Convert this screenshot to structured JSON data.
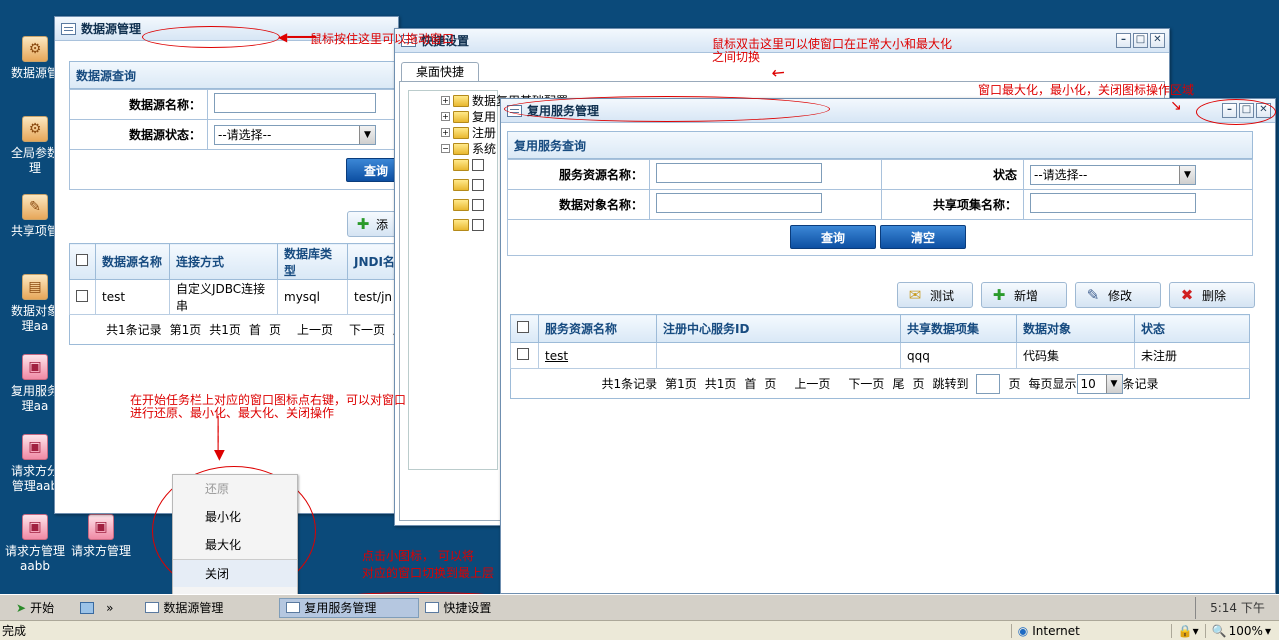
{
  "desktop_icons": [
    {
      "label": "数据源管",
      "kind": "gear"
    },
    {
      "label": "全局参数\n理",
      "kind": "gear"
    },
    {
      "label": "共享项管",
      "kind": "tag"
    },
    {
      "label": "数据对象\n理aa",
      "kind": "clip"
    },
    {
      "label": "复用服务\n理aa",
      "kind": "pink"
    },
    {
      "label": "请求方分\n管理aab",
      "kind": "pink"
    },
    {
      "label": "请求方管理\naabb",
      "kind": "pink"
    },
    {
      "label": "请求方管理",
      "kind": "pink"
    }
  ],
  "win_datasource": {
    "title": "数据源管理",
    "panel_title": "数据源查询",
    "name_label": "数据源名称：",
    "status_label": "数据源状态：",
    "status_value": "--请选择--",
    "query_btn": "查询",
    "add_btn": "添",
    "columns": [
      "数据源名称",
      "连接方式",
      "数据库类型",
      "JNDI名"
    ],
    "rows": [
      [
        "test",
        "自定义JDBC连接串",
        "mysql",
        "test/jn"
      ]
    ],
    "pager": [
      "共1条记录",
      "第1页",
      "共1页",
      "首",
      "页",
      "上一页",
      "下一页",
      "尾"
    ]
  },
  "win_shortcut": {
    "title": "快捷设置",
    "tab": "桌面快捷",
    "tree": [
      "数据复用基础配置",
      "复用",
      "注册",
      "系统"
    ]
  },
  "win_reuse": {
    "title": "复用服务管理",
    "panel_title": "复用服务查询",
    "res_label": "服务资源名称：",
    "state_label": "状态",
    "state_value": "--请选择--",
    "obj_label": "数据对象名称：",
    "share_label": "共享项集名称：",
    "query_btn": "查询",
    "clear_btn": "清空",
    "tools": {
      "test": "测试",
      "add": "新增",
      "edit": "修改",
      "delete": "删除"
    },
    "columns": [
      "服务资源名称",
      "注册中心服务ID",
      "共享数据项集",
      "数据对象",
      "状态"
    ],
    "rows": [
      [
        "test",
        "",
        "qqq",
        "代码集",
        "未注册"
      ]
    ],
    "pager": {
      "records": "共1条记录",
      "page": "第1页",
      "total": "共1页",
      "first": "首",
      "p": "页",
      "prev": "上一页",
      "next": "下一页",
      "last": "尾",
      "p2": "页",
      "jump": "跳转到",
      "pageunit": "页",
      "perpage": "每页显示",
      "perpage_value": "10",
      "recunit": "条记录"
    }
  },
  "notes": {
    "drag": "鼠标按住这里可以拖动窗口",
    "dblclick": "鼠标双击这里可以使窗口在正常大小和最大化\n之间切换",
    "winbtns": "窗口最大化，最小化，关闭图标操作区域",
    "rightclick": "在开始任务栏上对应的窗口图标点右键，可以对窗口\n进行还原、最小化、最大化、关闭操作",
    "taskclick": "点击小图标，  可以将\n对应的窗口切换到最上层"
  },
  "context_menu": [
    "还原",
    "最小化",
    "最大化",
    "关闭"
  ],
  "taskbar": {
    "start": "开始",
    "items": [
      "数据源管理",
      "复用服务管理",
      "快捷设置"
    ],
    "clock": "5:14 下午"
  },
  "statusbar": {
    "left": "完成",
    "zone": "Internet",
    "zoom": "100%"
  }
}
